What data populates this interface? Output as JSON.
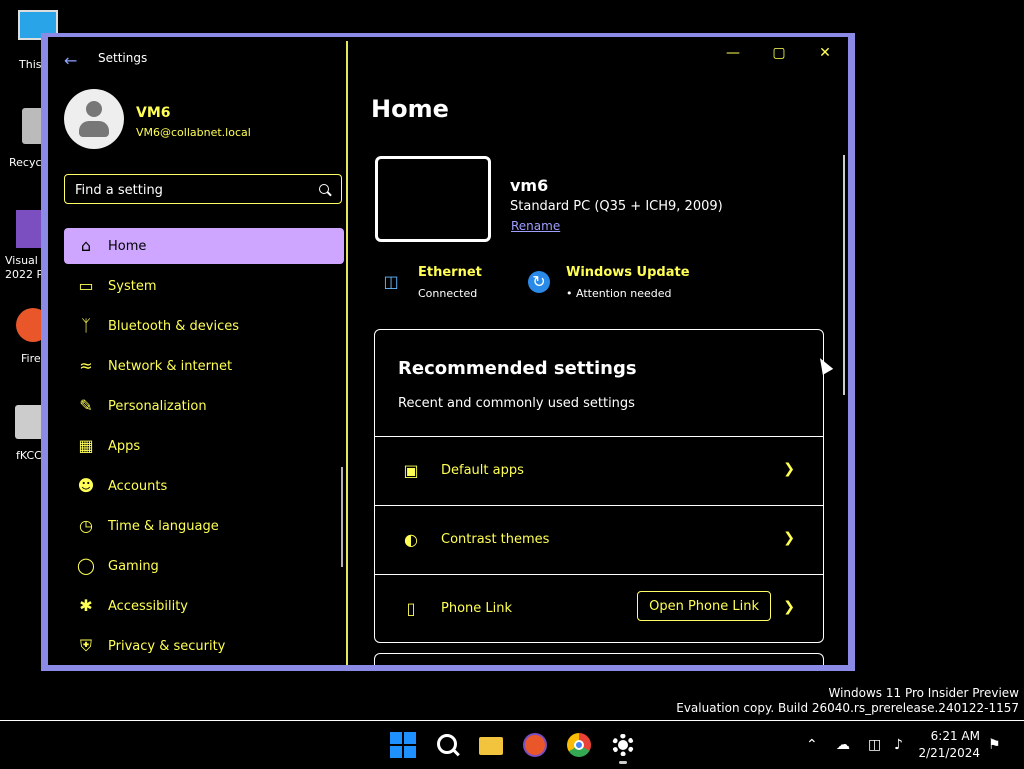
{
  "desktop": {
    "icons": [
      {
        "label": "This"
      },
      {
        "label": "Recyc"
      },
      {
        "label": "Visual"
      },
      {
        "label": "2022 P"
      },
      {
        "label": "Fire"
      },
      {
        "label": "fKCC"
      }
    ]
  },
  "window": {
    "title": "Settings",
    "minimize_glyph": "—",
    "maximize_glyph": "▢",
    "close_glyph": "✕"
  },
  "user": {
    "name": "VM6",
    "email": "VM6@collabnet.local"
  },
  "search": {
    "placeholder": "Find a setting"
  },
  "nav": {
    "items": [
      {
        "label": "Home",
        "icon": "home-icon",
        "active": true
      },
      {
        "label": "System",
        "icon": "monitor-icon"
      },
      {
        "label": "Bluetooth & devices",
        "icon": "bluetooth-icon"
      },
      {
        "label": "Network & internet",
        "icon": "wifi-icon"
      },
      {
        "label": "Personalization",
        "icon": "brush-icon"
      },
      {
        "label": "Apps",
        "icon": "apps-icon"
      },
      {
        "label": "Accounts",
        "icon": "person-icon"
      },
      {
        "label": "Time & language",
        "icon": "clock-language-icon"
      },
      {
        "label": "Gaming",
        "icon": "gamepad-icon"
      },
      {
        "label": "Accessibility",
        "icon": "accessibility-icon"
      },
      {
        "label": "Privacy & security",
        "icon": "shield-icon"
      }
    ]
  },
  "home": {
    "title": "Home",
    "device": {
      "name": "vm6",
      "description": "Standard PC (Q35 + ICH9, 2009)",
      "rename_label": "Rename"
    },
    "status": [
      {
        "title": "Ethernet",
        "subtitle": "Connected",
        "icon": "ethernet-icon"
      },
      {
        "title": "Windows Update",
        "subtitle": "• Attention needed",
        "icon": "windows-update-icon"
      }
    ],
    "recommended": {
      "title": "Recommended settings",
      "subtitle": "Recent and commonly used settings",
      "rows": [
        {
          "label": "Default apps",
          "icon": "default-apps-icon"
        },
        {
          "label": "Contrast themes",
          "icon": "contrast-icon"
        },
        {
          "label": "Phone Link",
          "icon": "phone-icon",
          "button": "Open Phone Link"
        }
      ]
    }
  },
  "watermark": {
    "line1": "Windows 11 Pro Insider Preview",
    "line2": "Evaluation copy. Build 26040.rs_prerelease.240122-1157"
  },
  "taskbar": {
    "time": "6:21 AM",
    "date": "2/21/2024"
  },
  "colors": {
    "accent_text": "#ffff55",
    "nav_active_bg": "#cfa6ff",
    "window_border": "#8b8be6",
    "link": "#9f9fff",
    "start_blue": "#1e90ff"
  }
}
